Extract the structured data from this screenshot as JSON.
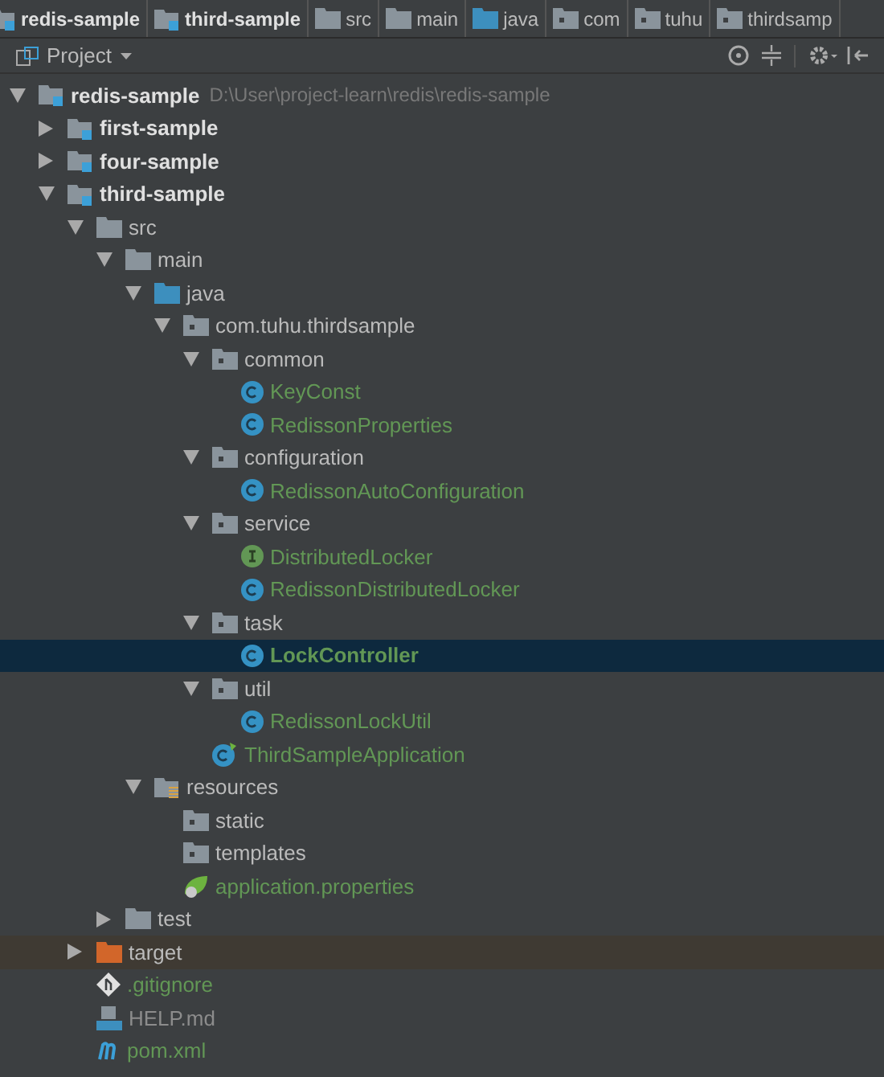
{
  "breadcrumbs": [
    {
      "label": "redis-sample",
      "kind": "module"
    },
    {
      "label": "third-sample",
      "kind": "module"
    },
    {
      "label": "src",
      "kind": "folder"
    },
    {
      "label": "main",
      "kind": "folder"
    },
    {
      "label": "java",
      "kind": "source"
    },
    {
      "label": "com",
      "kind": "package"
    },
    {
      "label": "tuhu",
      "kind": "package"
    },
    {
      "label": "thirdsamp",
      "kind": "package"
    }
  ],
  "panel": {
    "title": "Project"
  },
  "tree": [
    {
      "label": "redis-sample",
      "kind": "module",
      "path": "D:\\User\\project-learn\\redis\\redis-sample",
      "color": "#e0e0e0",
      "selected": false,
      "expanded": true,
      "children": [
        {
          "label": "first-sample",
          "kind": "module",
          "color": "#e0e0e0",
          "selected": false,
          "expanded": false
        },
        {
          "label": "four-sample",
          "kind": "module",
          "color": "#e0e0e0",
          "selected": false,
          "expanded": false
        },
        {
          "label": "third-sample",
          "kind": "module",
          "color": "#e0e0e0",
          "selected": false,
          "expanded": true,
          "children": [
            {
              "label": "src",
              "kind": "folder",
              "color": "#bbbbbb",
              "selected": false,
              "expanded": true,
              "children": [
                {
                  "label": "main",
                  "kind": "folder",
                  "color": "#bbbbbb",
                  "selected": false,
                  "expanded": true,
                  "children": [
                    {
                      "label": "java",
                      "kind": "source",
                      "color": "#bbbbbb",
                      "selected": false,
                      "expanded": true,
                      "children": [
                        {
                          "label": "com.tuhu.thirdsample",
                          "kind": "package",
                          "color": "#bbbbbb",
                          "selected": false,
                          "expanded": true,
                          "children": [
                            {
                              "label": "common",
                              "kind": "package",
                              "color": "#bbbbbb",
                              "selected": false,
                              "expanded": true,
                              "children": [
                                {
                                  "label": "KeyConst",
                                  "kind": "class",
                                  "color": "#629755",
                                  "selected": false
                                },
                                {
                                  "label": "RedissonProperties",
                                  "kind": "class",
                                  "color": "#629755",
                                  "selected": false
                                }
                              ]
                            },
                            {
                              "label": "configuration",
                              "kind": "package",
                              "color": "#bbbbbb",
                              "selected": false,
                              "expanded": true,
                              "children": [
                                {
                                  "label": "RedissonAutoConfiguration",
                                  "kind": "class",
                                  "color": "#629755",
                                  "selected": false
                                }
                              ]
                            },
                            {
                              "label": "service",
                              "kind": "package",
                              "color": "#bbbbbb",
                              "selected": false,
                              "expanded": true,
                              "children": [
                                {
                                  "label": "DistributedLocker",
                                  "kind": "interface",
                                  "color": "#629755",
                                  "selected": false
                                },
                                {
                                  "label": "RedissonDistributedLocker",
                                  "kind": "class",
                                  "color": "#629755",
                                  "selected": false
                                }
                              ]
                            },
                            {
                              "label": "task",
                              "kind": "package",
                              "color": "#bbbbbb",
                              "selected": false,
                              "expanded": true,
                              "children": [
                                {
                                  "label": "LockController",
                                  "kind": "class",
                                  "color": "#629755",
                                  "selected": true
                                }
                              ]
                            },
                            {
                              "label": "util",
                              "kind": "package",
                              "color": "#bbbbbb",
                              "selected": false,
                              "expanded": true,
                              "children": [
                                {
                                  "label": "RedissonLockUtil",
                                  "kind": "class",
                                  "color": "#629755",
                                  "selected": false
                                }
                              ]
                            },
                            {
                              "label": "ThirdSampleApplication",
                              "kind": "app",
                              "color": "#629755",
                              "selected": false
                            }
                          ]
                        }
                      ]
                    },
                    {
                      "label": "resources",
                      "kind": "resources",
                      "color": "#bbbbbb",
                      "selected": false,
                      "expanded": true,
                      "children": [
                        {
                          "label": "static",
                          "kind": "package",
                          "color": "#bbbbbb",
                          "selected": false
                        },
                        {
                          "label": "templates",
                          "kind": "package",
                          "color": "#bbbbbb",
                          "selected": false
                        },
                        {
                          "label": "application.properties",
                          "kind": "properties",
                          "color": "#629755",
                          "selected": false
                        }
                      ]
                    }
                  ]
                },
                {
                  "label": "test",
                  "kind": "folder",
                  "color": "#bbbbbb",
                  "selected": false,
                  "expanded": false
                }
              ]
            },
            {
              "label": "target",
              "kind": "excluded",
              "color": "#bbbbbb",
              "selected": false,
              "expanded": false
            },
            {
              "label": ".gitignore",
              "kind": "git",
              "color": "#629755",
              "selected": false
            },
            {
              "label": "HELP.md",
              "kind": "markdown",
              "color": "#8c8c8c",
              "selected": false
            },
            {
              "label": "pom.xml",
              "kind": "maven",
              "color": "#629755",
              "selected": false
            }
          ]
        }
      ]
    }
  ]
}
